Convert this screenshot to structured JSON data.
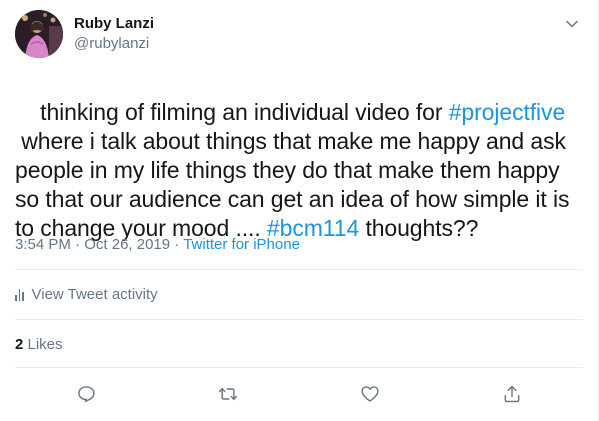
{
  "author": {
    "display_name": "Ruby Lanzi",
    "handle": "@rubylanzi"
  },
  "tweet": {
    "segments": [
      {
        "text": "thinking of filming an individual video for ",
        "type": "text"
      },
      {
        "text": "#projectfive",
        "type": "hashtag"
      },
      {
        "text": "\n where i talk about things that make me happy and ask people in my life things they do that make them happy so that our audience can get an idea of how simple it is to change your mood .... ",
        "type": "text"
      },
      {
        "text": "#bcm114",
        "type": "hashtag"
      },
      {
        "text": " thoughts??",
        "type": "text"
      }
    ]
  },
  "meta": {
    "time": "3:54 PM",
    "separator1": " · ",
    "date": "Oct 26, 2019",
    "separator2": " · ",
    "source": "Twitter for iPhone"
  },
  "activity": {
    "label": "View Tweet activity",
    "icon": "bar-chart-icon"
  },
  "likes": {
    "count": "2",
    "label": " Likes"
  },
  "actions": {
    "reply_icon": "reply-icon",
    "retweet_icon": "retweet-icon",
    "like_icon": "heart-icon",
    "share_icon": "share-icon"
  },
  "colors": {
    "hashtag": "#1b95e0",
    "secondary_text": "#657786",
    "primary_text": "#14171a",
    "divider": "#e6ecf0"
  }
}
